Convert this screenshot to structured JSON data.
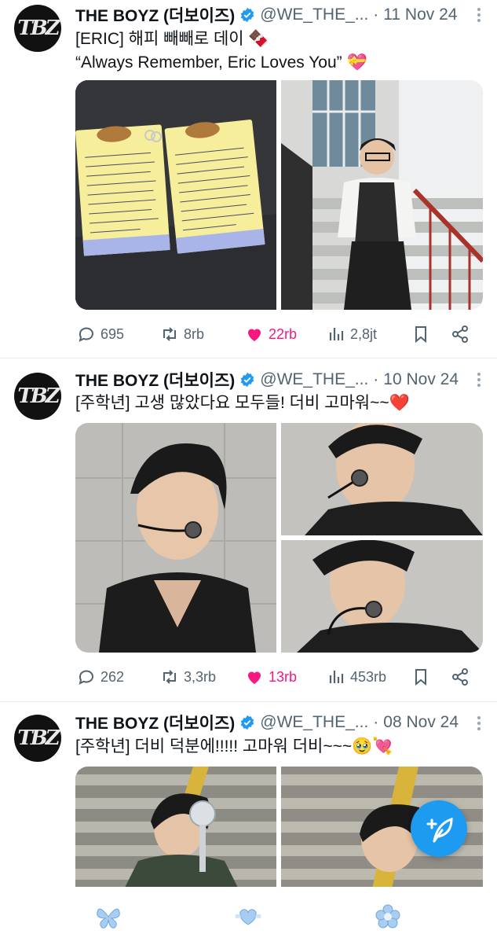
{
  "theme": {
    "accent": "#1d9bf0",
    "like_color": "#f91880",
    "muted": "#536471"
  },
  "tweets": [
    {
      "author_name": "THE BOYZ (더보이즈)",
      "handle": "@WE_THE_...",
      "date": "11 Nov 24",
      "text_lines": [
        "[ERIC] 해피 빼빼로 데이 🍫",
        "“Always Remember, Eric Loves You” 💝"
      ],
      "media": [
        "handwritten-letters-photo",
        "eric-on-staircase-photo"
      ],
      "replies": "695",
      "retweets": "8rb",
      "likes": "22rb",
      "views": "2,8jt",
      "liked": true
    },
    {
      "author_name": "THE BOYZ (더보이즈)",
      "handle": "@WE_THE_...",
      "date": "10 Nov 24",
      "text_lines": [
        "[주학년] 고생 많았다요 모두들! 더비 고마워~~❤️"
      ],
      "media": [
        "selfie-with-headset-mic",
        "selfie-closeup-1",
        "selfie-closeup-2"
      ],
      "replies": "262",
      "retweets": "3,3rb",
      "likes": "13rb",
      "views": "453rb",
      "liked": true
    },
    {
      "author_name": "THE BOYZ (더보이즈)",
      "handle": "@WE_THE_...",
      "date": "08 Nov 24",
      "text_lines": [
        "[주학년] 더비 덕분에!!!!! 고마워 더비~~~🥹💘"
      ],
      "media": [
        "photo-holding-lightstick",
        "photo-portrait"
      ]
    }
  ],
  "avatar_logo_text": "TBZ",
  "icons": {
    "reply": "reply-icon",
    "retweet": "retweet-icon",
    "like": "heart-icon",
    "views": "views-icon",
    "bookmark": "bookmark-icon",
    "share": "share-icon",
    "compose": "compose-icon",
    "nav1": "butterfly-icon",
    "nav2": "heart-wings-icon",
    "nav3": "flower-icon"
  }
}
